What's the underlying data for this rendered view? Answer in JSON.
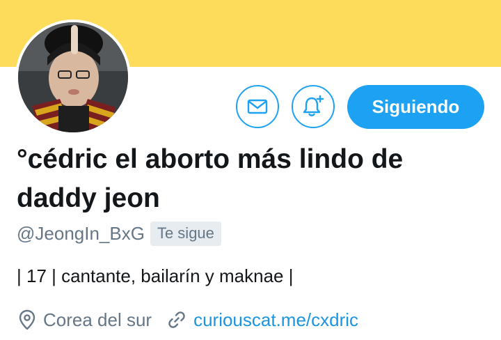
{
  "colors": {
    "banner": "#FDDC5C",
    "accent": "#1DA1F2",
    "link": "#1B95E0",
    "secondary_text": "#657786",
    "primary_text": "#14171A",
    "badge_bg": "#E6ECF0"
  },
  "profile": {
    "display_name_line1": "°cédric el aborto más lindo de",
    "display_name_line2": "daddy jeon",
    "handle": "@JeongIn_BxG",
    "follows_you_badge": "Te sigue",
    "bio": "| 17 | cantante, bailarín y maknae |",
    "location": "Corea del sur",
    "website": "curiouscat.me/cxdric"
  },
  "actions": {
    "message_icon": "envelope-icon",
    "notifications_icon": "bell-plus-icon",
    "follow_button_label": "Siguiendo"
  },
  "icons": {
    "location": "location-pin-icon",
    "website": "link-icon"
  }
}
